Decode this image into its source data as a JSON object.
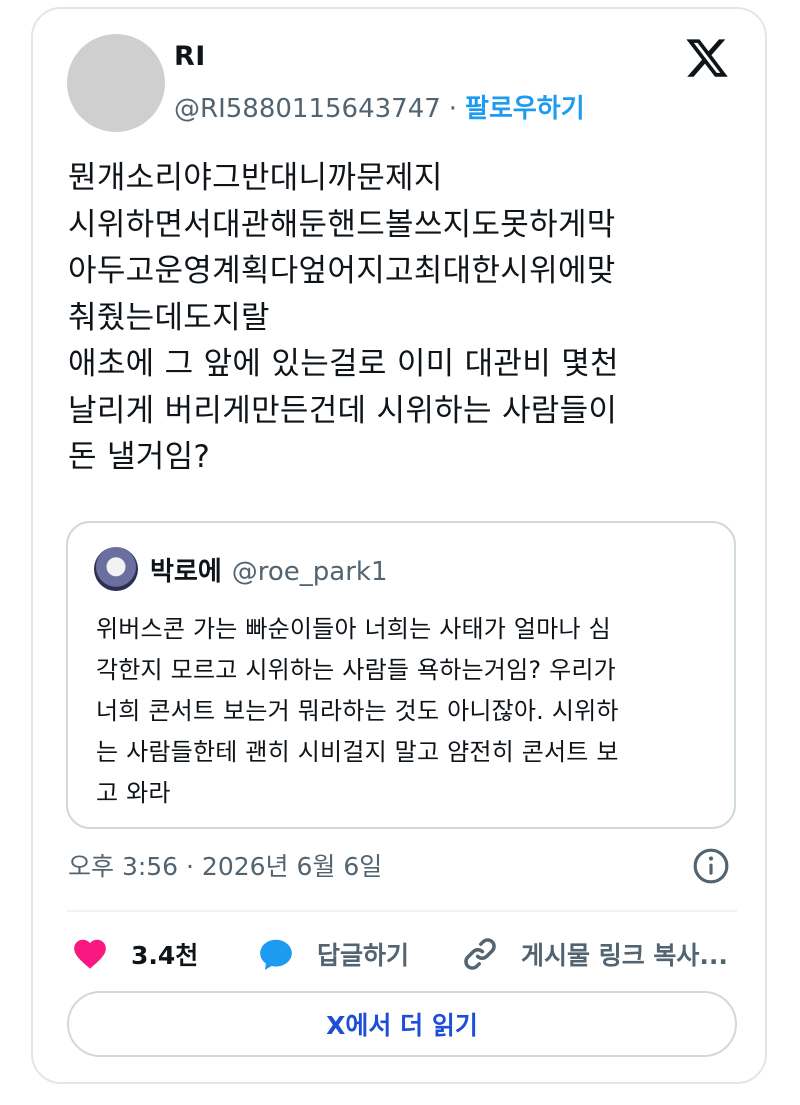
{
  "author": {
    "display_name": "RI",
    "handle": "@RI5880115643747",
    "separator": "·",
    "follow_label": "팔로우하기"
  },
  "tweet": {
    "text": "뭔개소리야그반대니까문제지\n시위하면서대관해둔핸드볼쓰지도못하게막\n아두고운영계획다엎어지고최대한시위에맞\n춰줬는데도지랄\n애초에 그 앞에 있는걸로 이미 대관비 몇천\n날리게 버리게만든건데 시위하는 사람들이\n돈 낼거임?"
  },
  "quoted": {
    "name": "박로에",
    "handle": "@roe_park1",
    "text": "위버스콘 가는 빠순이들아 너희는 사태가 얼마나 심\n각한지 모르고 시위하는 사람들 욕하는거임? 우리가\n너희 콘서트 보는거 뭐라하는 것도 아니잖아. 시위하\n는 사람들한테 괜히 시비걸지 말고 얌전히 콘서트 보\n고 와라"
  },
  "timestamp": "오후 3:56 · 2026년 6월 6일",
  "actions": {
    "like_count": "3.4천",
    "reply_label": "답글하기",
    "copy_link_label": "게시물 링크 복사..."
  },
  "read_more_label": "X에서 더 읽기",
  "colors": {
    "accent": "#1d9bf0",
    "like": "#f91880",
    "muted": "#536471",
    "text": "#0f1419"
  },
  "icons": [
    "x-logo-icon",
    "info-icon",
    "heart-icon",
    "reply-bubble-icon",
    "link-icon"
  ]
}
